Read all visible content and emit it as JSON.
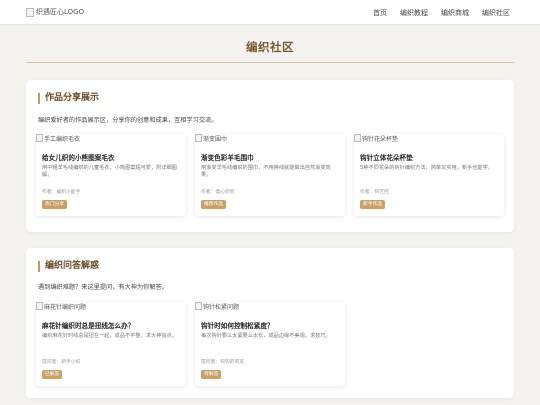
{
  "header": {
    "logo_alt": "织遇匠心LOGO",
    "nav": [
      "首页",
      "编织教程",
      "编织商城",
      "编织社区"
    ]
  },
  "page": {
    "title": "编织社区"
  },
  "showcase": {
    "title": "作品分享展示",
    "desc": "编织爱好者的作品展示区，分享你的创意和成果，互相学习交流。",
    "cards": [
      {
        "img_alt": "手工编织毛衣",
        "title": "给女儿织的小熊图案毛衣",
        "desc": "用中粗羊毛线编织的儿童毛衣，小熊图案超可爱，附详细图解。",
        "author": "作者：编织小能手",
        "tag": "热门分享"
      },
      {
        "img_alt": "渐变围巾",
        "title": "渐变色彩羊毛围巾",
        "desc": "用渐变羊毛线编织的围巾，不用换线就能做出自然渐变效果。",
        "author": "作者：慢心织织",
        "tag": "推荐作品"
      },
      {
        "img_alt": "钩针花朵杯垫",
        "title": "钩针立体花朵杯垫",
        "desc": "5种不同花朵的钩针编织方法，简单又实用，新手也能学。",
        "author": "作者：钩艺控",
        "tag": "新手作品"
      }
    ]
  },
  "qa": {
    "title": "编织问答解惑",
    "desc": "遇到编织难题？来这里提问，有大神为你解答。",
    "cards": [
      {
        "img_alt": "麻花针编织问题",
        "title": "麻花针编织时总是扭线怎么办？",
        "desc": "编织麻花针时线总是扭在一起，成品不平整，求大神指点。",
        "author": "提问者：新手小织",
        "tag": "已解答"
      },
      {
        "img_alt": "钩针松紧问题",
        "title": "钩针时如何控制松紧度？",
        "desc": "每次钩针要么太紧要么太松，成品边缘不美观，求技巧。",
        "author": "提问者：钩钩的阿友",
        "tag": "待解答"
      }
    ]
  }
}
